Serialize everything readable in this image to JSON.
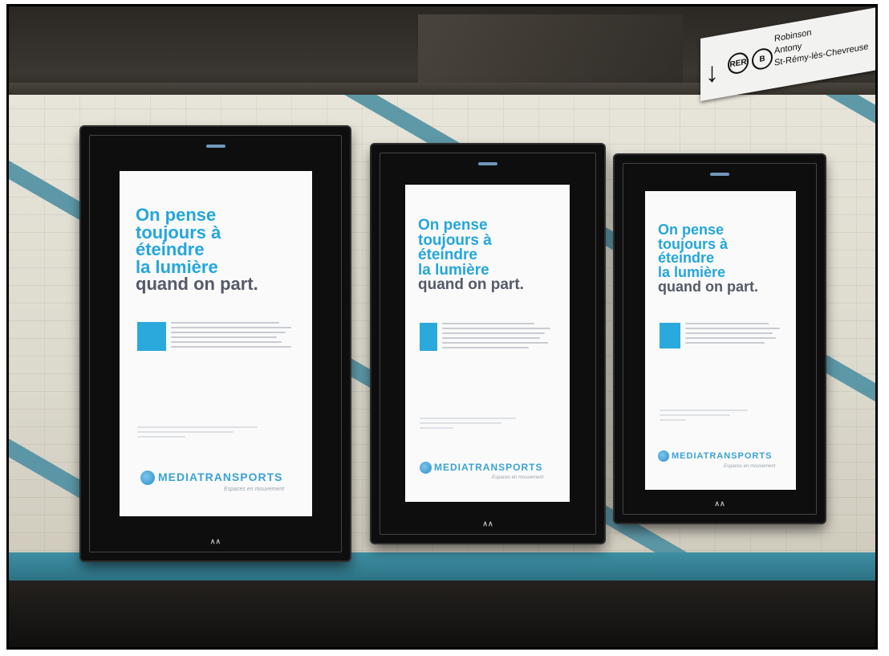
{
  "sign": {
    "arrow": "↓",
    "badges": [
      "RER",
      "B"
    ],
    "lines": [
      "Robinson",
      "Antony",
      "St-Rémy-lès-Chevreuse"
    ]
  },
  "poster": {
    "headline_blue": [
      "On pense",
      "toujours à",
      "éteindre",
      "la lumière"
    ],
    "headline_grey": "quand on part.",
    "brand": "MEDIATRANSPORTS",
    "tagline": "Espaces en mouvement"
  },
  "colors": {
    "headline_blue": "#24a6dc",
    "headline_grey": "#555a68",
    "brand_blue": "#3aa2d6"
  }
}
